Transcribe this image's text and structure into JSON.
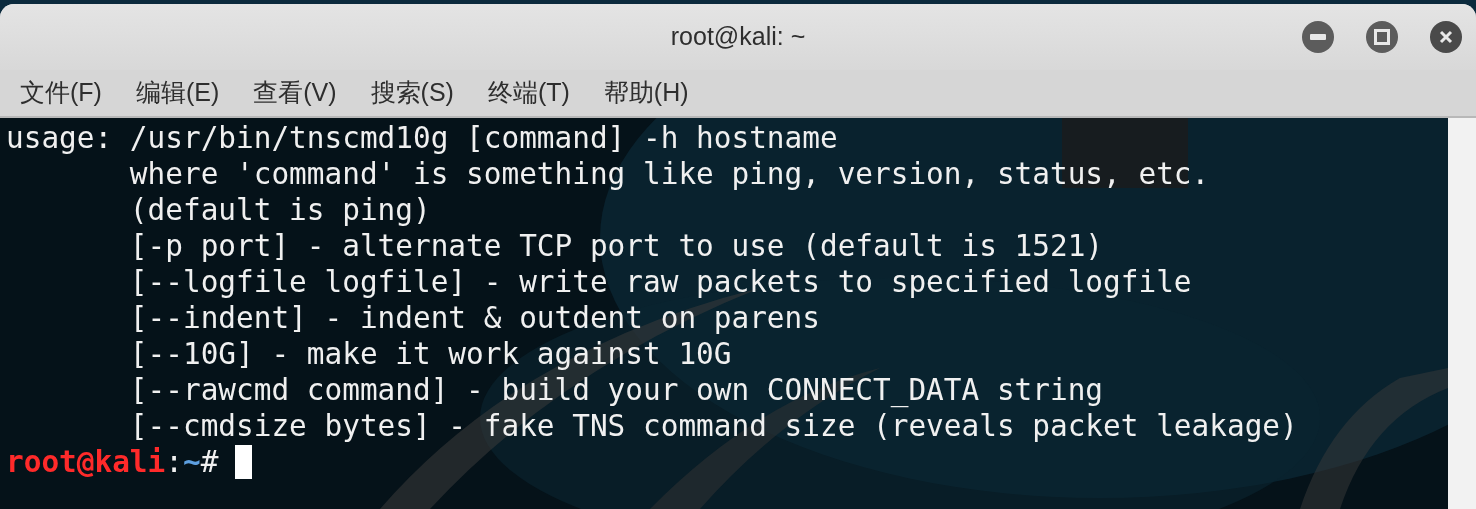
{
  "window": {
    "title": "root@kali: ~"
  },
  "menu": [
    "文件(F)",
    "编辑(E)",
    "查看(V)",
    "搜索(S)",
    "终端(T)",
    "帮助(H)"
  ],
  "terminal": {
    "lines": [
      "usage: /usr/bin/tnscmd10g [command] -h hostname",
      "       where 'command' is something like ping, version, status, etc.",
      "       (default is ping)",
      "       [-p port] - alternate TCP port to use (default is 1521)",
      "       [--logfile logfile] - write raw packets to specified logfile",
      "       [--indent] - indent & outdent on parens",
      "       [--10G] - make it work against 10G",
      "       [--rawcmd command] - build your own CONNECT_DATA string",
      "       [--cmdsize bytes] - fake TNS command size (reveals packet leakage)"
    ],
    "prompt": {
      "user_host": "root@kali",
      "separator": ":",
      "path": "~",
      "symbol": "#"
    }
  }
}
